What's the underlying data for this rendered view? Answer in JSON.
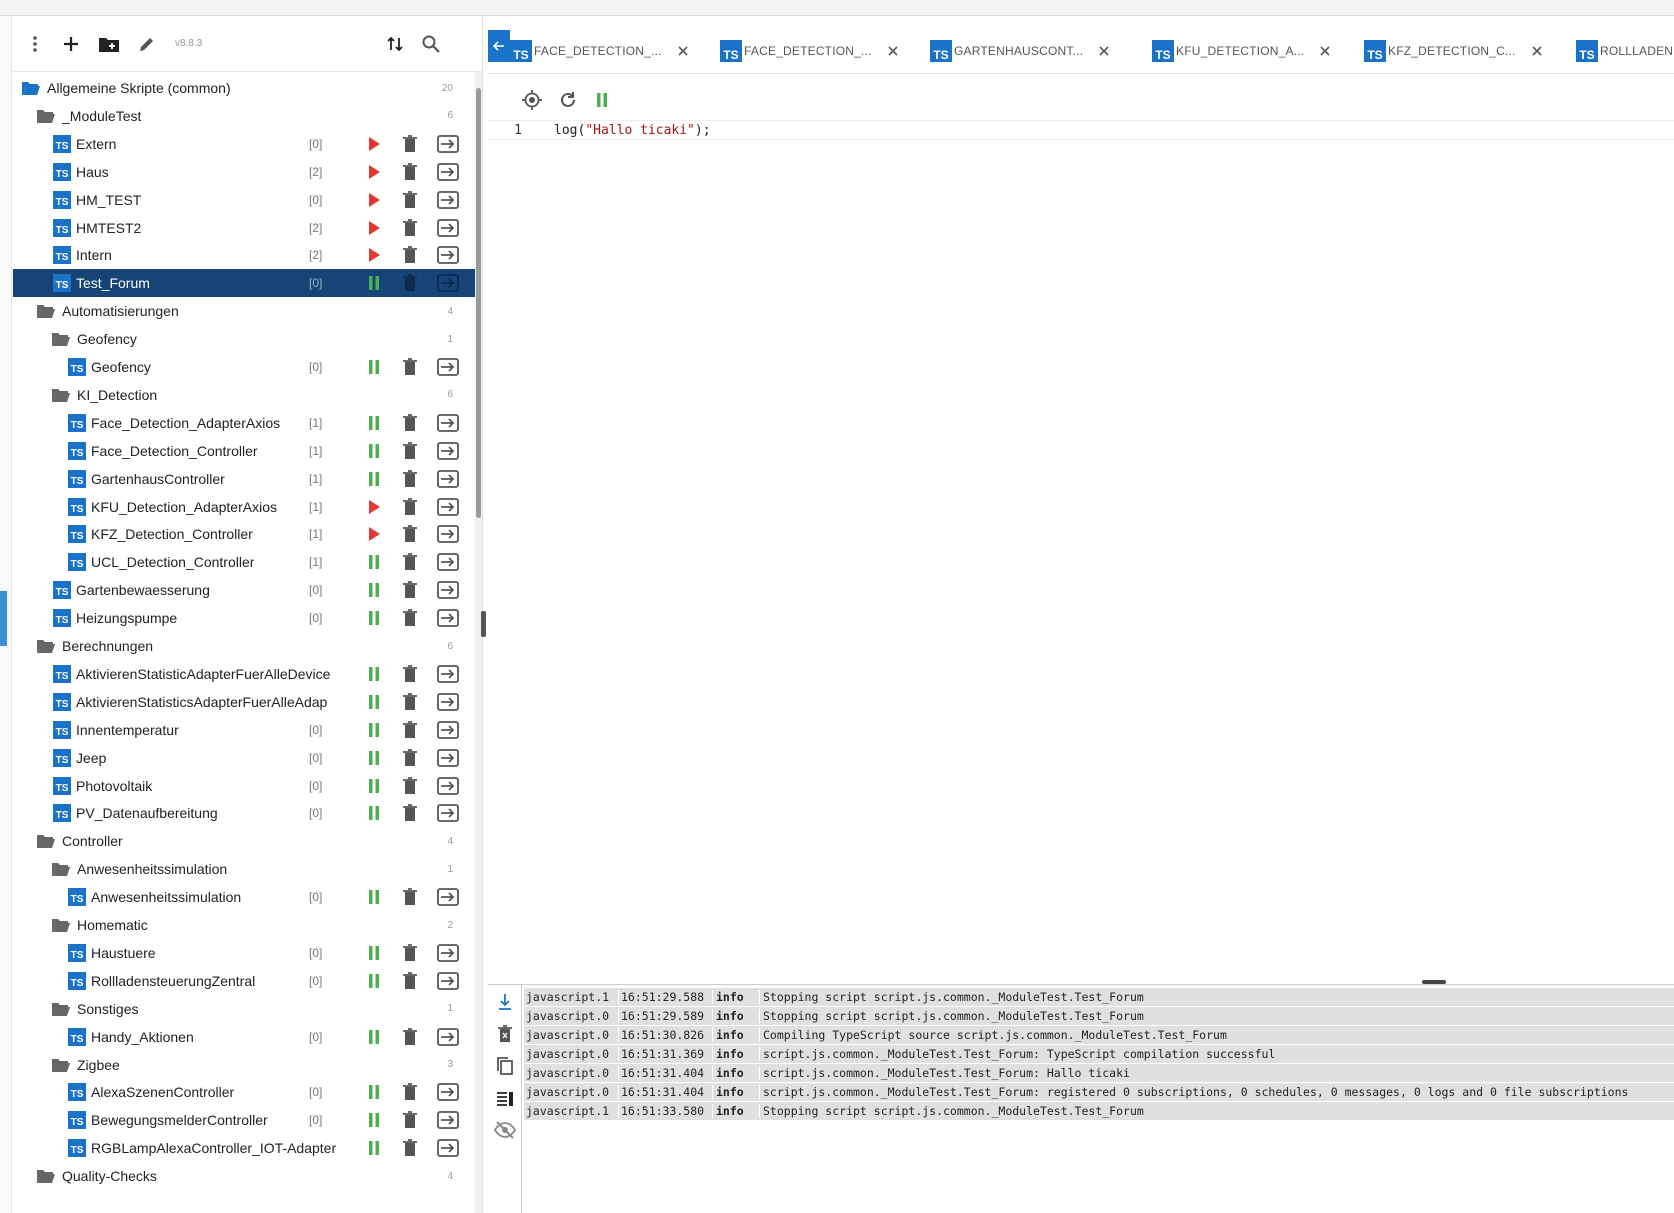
{
  "app": {
    "version": "v8.8.3"
  },
  "toolbar": {
    "icons": [
      "more-vert-icon",
      "add-icon",
      "add-folder-icon",
      "edit-icon",
      "sort-icon",
      "search-icon"
    ]
  },
  "tree": [
    {
      "type": "folder",
      "level": 0,
      "name": "Allgemeine Skripte (common)",
      "count": "20",
      "open": true
    },
    {
      "type": "folder",
      "level": 1,
      "name": "_ModuleTest",
      "count": "6",
      "open": true
    },
    {
      "type": "script",
      "level": 2,
      "name": "Extern",
      "debug": "[0]",
      "state": "stopped"
    },
    {
      "type": "script",
      "level": 2,
      "name": "Haus",
      "debug": "[2]",
      "state": "stopped"
    },
    {
      "type": "script",
      "level": 2,
      "name": "HM_TEST",
      "debug": "[0]",
      "state": "stopped"
    },
    {
      "type": "script",
      "level": 2,
      "name": "HMTEST2",
      "debug": "[2]",
      "state": "stopped"
    },
    {
      "type": "script",
      "level": 2,
      "name": "Intern",
      "debug": "[2]",
      "state": "stopped"
    },
    {
      "type": "script",
      "level": 2,
      "name": "Test_Forum",
      "debug": "[0]",
      "state": "running",
      "selected": true
    },
    {
      "type": "folder",
      "level": 1,
      "name": "Automatisierungen",
      "count": "4",
      "open": true
    },
    {
      "type": "folder",
      "level": 2,
      "name": "Geofency",
      "count": "1",
      "open": true
    },
    {
      "type": "script",
      "level": 3,
      "name": "Geofency",
      "debug": "[0]",
      "state": "running"
    },
    {
      "type": "folder",
      "level": 2,
      "name": "KI_Detection",
      "count": "6",
      "open": true
    },
    {
      "type": "script",
      "level": 3,
      "name": "Face_Detection_AdapterAxios",
      "debug": "[1]",
      "state": "running"
    },
    {
      "type": "script",
      "level": 3,
      "name": "Face_Detection_Controller",
      "debug": "[1]",
      "state": "running"
    },
    {
      "type": "script",
      "level": 3,
      "name": "GartenhausController",
      "debug": "[1]",
      "state": "running"
    },
    {
      "type": "script",
      "level": 3,
      "name": "KFU_Detection_AdapterAxios",
      "debug": "[1]",
      "state": "stopped"
    },
    {
      "type": "script",
      "level": 3,
      "name": "KFZ_Detection_Controller",
      "debug": "[1]",
      "state": "stopped"
    },
    {
      "type": "script",
      "level": 3,
      "name": "UCL_Detection_Controller",
      "debug": "[1]",
      "state": "running"
    },
    {
      "type": "script",
      "level": 2,
      "name": "Gartenbewaesserung",
      "debug": "[0]",
      "state": "running"
    },
    {
      "type": "script",
      "level": 2,
      "name": "Heizungspumpe",
      "debug": "[0]",
      "state": "running"
    },
    {
      "type": "folder",
      "level": 1,
      "name": "Berechnungen",
      "count": "6",
      "open": true
    },
    {
      "type": "script",
      "level": 2,
      "name": "AktivierenStatisticAdapterFuerAlleDevice",
      "debug": "",
      "state": "running"
    },
    {
      "type": "script",
      "level": 2,
      "name": "AktivierenStatisticsAdapterFuerAlleAdap",
      "debug": "",
      "state": "running"
    },
    {
      "type": "script",
      "level": 2,
      "name": "Innentemperatur",
      "debug": "[0]",
      "state": "running"
    },
    {
      "type": "script",
      "level": 2,
      "name": "Jeep",
      "debug": "[0]",
      "state": "running"
    },
    {
      "type": "script",
      "level": 2,
      "name": "Photovoltaik",
      "debug": "[0]",
      "state": "running"
    },
    {
      "type": "script",
      "level": 2,
      "name": "PV_Datenaufbereitung",
      "debug": "[0]",
      "state": "running"
    },
    {
      "type": "folder",
      "level": 1,
      "name": "Controller",
      "count": "4",
      "open": true
    },
    {
      "type": "folder",
      "level": 2,
      "name": "Anwesenheitssimulation",
      "count": "1",
      "open": true
    },
    {
      "type": "script",
      "level": 3,
      "name": "Anwesenheitssimulation",
      "debug": "[0]",
      "state": "running"
    },
    {
      "type": "folder",
      "level": 2,
      "name": "Homematic",
      "count": "2",
      "open": true
    },
    {
      "type": "script",
      "level": 3,
      "name": "Haustuere",
      "debug": "[0]",
      "state": "running"
    },
    {
      "type": "script",
      "level": 3,
      "name": "RollladensteuerungZentral",
      "debug": "[0]",
      "state": "running"
    },
    {
      "type": "folder",
      "level": 2,
      "name": "Sonstiges",
      "count": "1",
      "open": true
    },
    {
      "type": "script",
      "level": 3,
      "name": "Handy_Aktionen",
      "debug": "[0]",
      "state": "running"
    },
    {
      "type": "folder",
      "level": 2,
      "name": "Zigbee",
      "count": "3",
      "open": true
    },
    {
      "type": "script",
      "level": 3,
      "name": "AlexaSzenenController",
      "debug": "[0]",
      "state": "running"
    },
    {
      "type": "script",
      "level": 3,
      "name": "BewegungsmelderController",
      "debug": "[0]",
      "state": "running"
    },
    {
      "type": "script",
      "level": 3,
      "name": "RGBLampAlexaController_IOT-Adapter",
      "debug": "",
      "state": "running"
    },
    {
      "type": "folder",
      "level": 1,
      "name": "Quality-Checks",
      "count": "4",
      "open": true
    }
  ],
  "tabs": [
    {
      "label": "FACE_DETECTION_..."
    },
    {
      "label": "FACE_DETECTION_..."
    },
    {
      "label": "GARTENHAUSCONT..."
    },
    {
      "label": "KFU_DETECTION_A..."
    },
    {
      "label": "KFZ_DETECTION_C..."
    },
    {
      "label": "ROLLLADEN"
    }
  ],
  "editor": {
    "line_number": "1",
    "code_prefix": "log(",
    "code_string": "\"Hallo ticaki\"",
    "code_suffix": ");"
  },
  "log": [
    {
      "src": "javascript.1",
      "time": "16:51:29.588",
      "sev": "info",
      "msg": "Stopping script script.js.common._ModuleTest.Test_Forum"
    },
    {
      "src": "javascript.0",
      "time": "16:51:29.589",
      "sev": "info",
      "msg": "Stopping script script.js.common._ModuleTest.Test_Forum"
    },
    {
      "src": "javascript.0",
      "time": "16:51:30.826",
      "sev": "info",
      "msg": "Compiling TypeScript source script.js.common._ModuleTest.Test_Forum"
    },
    {
      "src": "javascript.0",
      "time": "16:51:31.369",
      "sev": "info",
      "msg": "script.js.common._ModuleTest.Test_Forum: TypeScript compilation successful"
    },
    {
      "src": "javascript.0",
      "time": "16:51:31.404",
      "sev": "info",
      "msg": "script.js.common._ModuleTest.Test_Forum: Hallo ticaki"
    },
    {
      "src": "javascript.0",
      "time": "16:51:31.404",
      "sev": "info",
      "msg": "script.js.common._ModuleTest.Test_Forum: registered 0 subscriptions, 0 schedules, 0 messages, 0 logs and 0 file subscriptions"
    },
    {
      "src": "javascript.1",
      "time": "16:51:33.580",
      "sev": "info",
      "msg": "Stopping script script.js.common._ModuleTest.Test_Forum"
    }
  ],
  "colors": {
    "accent": "#1a73c8",
    "selected": "#164477",
    "run_green": "#4caf50",
    "stop_red": "#e53935"
  }
}
